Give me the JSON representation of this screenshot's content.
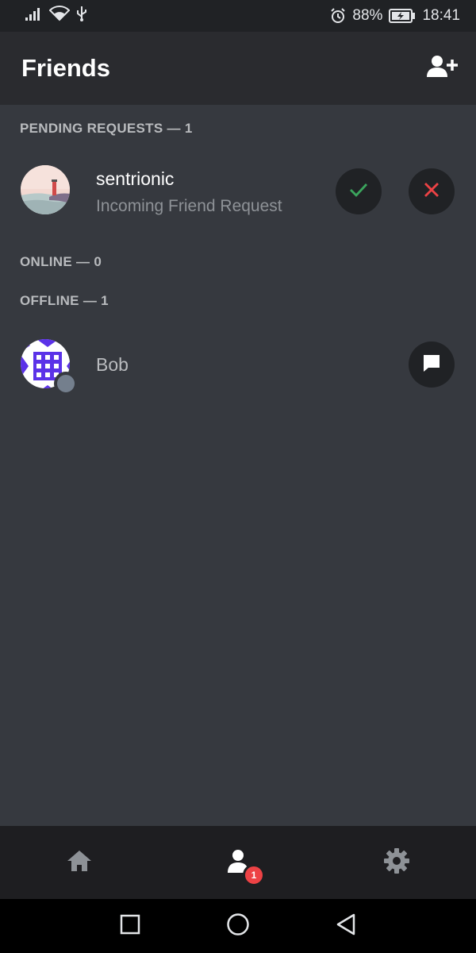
{
  "status_bar": {
    "battery_percent": "88%",
    "time": "18:41",
    "icons": [
      "signal-icon",
      "wifi-icon",
      "usb-icon",
      "alarm-icon",
      "battery-charging-icon"
    ]
  },
  "header": {
    "title": "Friends",
    "add_friend_icon": "add-friend-icon"
  },
  "sections": {
    "pending": {
      "label": "PENDING REQUESTS — 1",
      "items": [
        {
          "name": "sentrionic",
          "subtext": "Incoming Friend Request",
          "accept_icon": "check-icon",
          "decline_icon": "close-icon"
        }
      ]
    },
    "online": {
      "label": "ONLINE — 0"
    },
    "offline": {
      "label": "OFFLINE — 1",
      "items": [
        {
          "name": "Bob",
          "status": "offline",
          "message_icon": "message-icon"
        }
      ]
    }
  },
  "bottom_nav": {
    "items": [
      {
        "icon": "home-icon",
        "active": false
      },
      {
        "icon": "friends-icon",
        "active": true,
        "badge": "1"
      },
      {
        "icon": "settings-gear-icon",
        "active": false
      }
    ]
  },
  "system_nav": [
    "recent-apps-icon",
    "home-circle-icon",
    "back-icon"
  ],
  "colors": {
    "background": "#36393f",
    "header": "#2a2b2f",
    "accept": "#3ba55d",
    "decline": "#ed4245",
    "badge": "#ed4245",
    "offline_dot": "#747f8d",
    "avatar_bob": "#5b32e8"
  }
}
